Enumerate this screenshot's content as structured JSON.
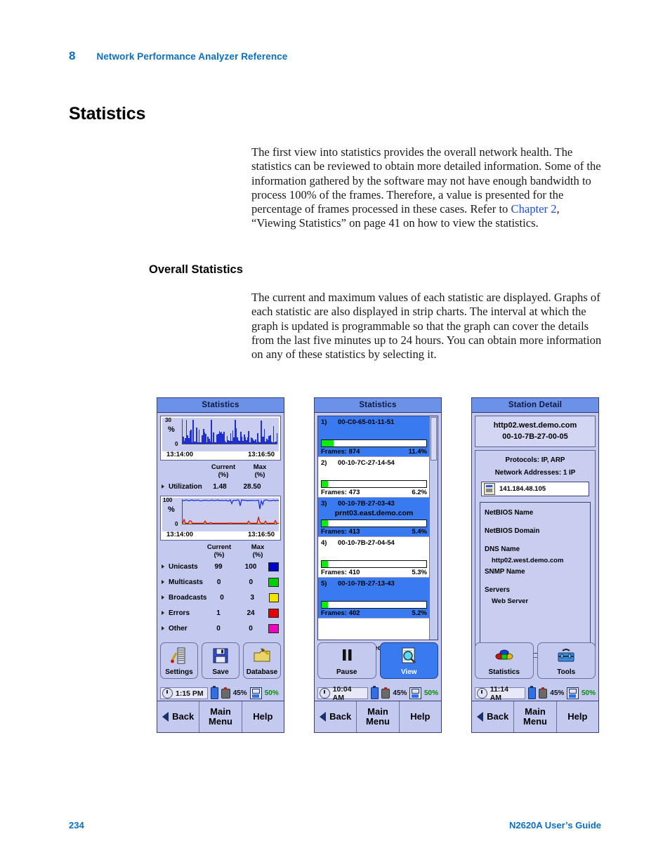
{
  "header": {
    "chapter_number": "8",
    "chapter_title": "Network Performance Analyzer Reference"
  },
  "headings": {
    "section": "Statistics",
    "subsection": "Overall Statistics"
  },
  "paragraphs": {
    "intro_1": "The first view into statistics provides the overall network health. The statistics can be reviewed to obtain more detailed information. Some of the information gathered by the software may not have enough bandwidth to process 100% of the frames. Therefore, a value is presented for the percentage of frames processed in these cases. Refer to ",
    "intro_link": "Chapter 2",
    "intro_2": ", “Viewing Statistics” on page 41 on how to view the statistics.",
    "overall": "The current and maximum values of each statistic are displayed. Graphs of each statistic are also displayed in strip charts. The interval at which the graph is updated is programmable so that the graph can cover the details from the last five minutes up to 24 hours. You can obtain more information on any of these statistics by selecting it."
  },
  "footer": {
    "page_number": "234",
    "guide_title": "N2620A User’s Guide"
  },
  "colors": {
    "accent_blue": "#0a6fc2",
    "link_blue": "#1f4fd8",
    "titlebar": "#6c92e8",
    "panel_bg": "#c3c9ef",
    "selection": "#3a7af0",
    "bar_blue": "#1f2fd0",
    "gauge_green": "#12e812",
    "swatch_unicasts": "#0000cc",
    "swatch_multicasts": "#00d000",
    "swatch_broadcasts": "#f2e400",
    "swatch_errors": "#e60000",
    "swatch_other": "#f000c0"
  },
  "device1": {
    "title": "Statistics",
    "chart1": {
      "ymax_label": "30",
      "ymin_label": "0",
      "unit": "%",
      "time_start": "13:14:00",
      "time_end": "13:16:50"
    },
    "chart2": {
      "ymax_label": "100",
      "ymin_label": "0",
      "unit": "%",
      "time_start": "13:14:00",
      "time_end": "13:16:50"
    },
    "table1": {
      "headers": [
        "Current",
        "Max"
      ],
      "subheaders": [
        "(%)",
        "(%)"
      ],
      "rows": [
        {
          "name": "Utilization",
          "current": "1.48",
          "max": "28.50",
          "swatch": ""
        }
      ]
    },
    "table2": {
      "headers": [
        "Current",
        "Max"
      ],
      "subheaders": [
        "(%)",
        "(%)"
      ],
      "rows": [
        {
          "name": "Unicasts",
          "current": "99",
          "max": "100",
          "swatch": "#0000cc"
        },
        {
          "name": "Multicasts",
          "current": "0",
          "max": "0",
          "swatch": "#00d000"
        },
        {
          "name": "Broadcasts",
          "current": "0",
          "max": "3",
          "swatch": "#f2e400"
        },
        {
          "name": "Errors",
          "current": "1",
          "max": "24",
          "swatch": "#e60000"
        },
        {
          "name": "Other",
          "current": "0",
          "max": "0",
          "swatch": "#f000c0"
        }
      ]
    },
    "buttons": [
      {
        "label": "Settings",
        "icon": "settings-icon",
        "active": false
      },
      {
        "label": "Save",
        "icon": "floppy-disk-icon",
        "active": false
      },
      {
        "label": "Database",
        "icon": "database-folder-icon",
        "active": false
      }
    ],
    "status": {
      "time": "1:15 PM",
      "battery_pct": "45%",
      "storage_pct": "50%"
    },
    "nav": {
      "back": "Back",
      "main_menu": "Main\nMenu",
      "help": "Help"
    }
  },
  "device2": {
    "title": "Statistics",
    "list": [
      {
        "index": "1)",
        "mac": "00-C0-65-01-11-51",
        "name": "",
        "frames_label": "Frames: 874",
        "percent": "11.4%",
        "bar_pct": 11.4,
        "selected": true
      },
      {
        "index": "2)",
        "mac": "00-10-7C-27-14-54",
        "name": "",
        "frames_label": "Frames: 473",
        "percent": "6.2%",
        "bar_pct": 6.2,
        "selected": false
      },
      {
        "index": "3)",
        "mac": "00-10-7B-27-03-43",
        "name": "prnt03.east.demo.com",
        "frames_label": "Frames: 413",
        "percent": "5.4%",
        "bar_pct": 5.4,
        "selected": true
      },
      {
        "index": "4)",
        "mac": "00-10-7B-27-04-54",
        "name": "",
        "frames_label": "Frames: 410",
        "percent": "5.3%",
        "bar_pct": 5.3,
        "selected": false
      },
      {
        "index": "5)",
        "mac": "00-10-7B-27-13-43",
        "name": "",
        "frames_label": "Frames: 402",
        "percent": "5.2%",
        "bar_pct": 5.2,
        "selected": true
      }
    ],
    "frames_processed": "Frames Processed: 0.0%",
    "buttons": [
      {
        "label": "Pause",
        "icon": "pause-icon",
        "active": false
      },
      {
        "label": "View",
        "icon": "magnifier-document-icon",
        "active": true
      }
    ],
    "status": {
      "time": "10:04 AM",
      "battery_pct": "45%",
      "storage_pct": "50%"
    },
    "nav": {
      "back": "Back",
      "main_menu": "Main\nMenu",
      "help": "Help"
    }
  },
  "device3": {
    "title": "Station Detail",
    "host": {
      "name": "http02.west.demo.com",
      "mac": "00-10-7B-27-00-05"
    },
    "protocols": "Protocols: IP, ARP",
    "network_addresses_label": "Network Addresses: 1 IP",
    "ip_address": "141.184.48.105",
    "details": [
      {
        "label": "NetBIOS Name",
        "value": ""
      },
      {
        "label": "NetBIOS Domain",
        "value": ""
      },
      {
        "label": "DNS Name",
        "value": "http02.west.demo.com"
      },
      {
        "label": "SNMP Name",
        "value": ""
      },
      {
        "label": "Servers",
        "value": "Web Server"
      }
    ],
    "buttons": [
      {
        "label": "Statistics",
        "icon": "stacked-disks-icon",
        "active": false
      },
      {
        "label": "Tools",
        "icon": "toolbox-icon",
        "active": false
      }
    ],
    "status": {
      "time": "11:14 AM",
      "battery_pct": "45%",
      "storage_pct": "50%"
    },
    "nav": {
      "back": "Back",
      "main_menu": "Main\nMenu",
      "help": "Help"
    }
  }
}
